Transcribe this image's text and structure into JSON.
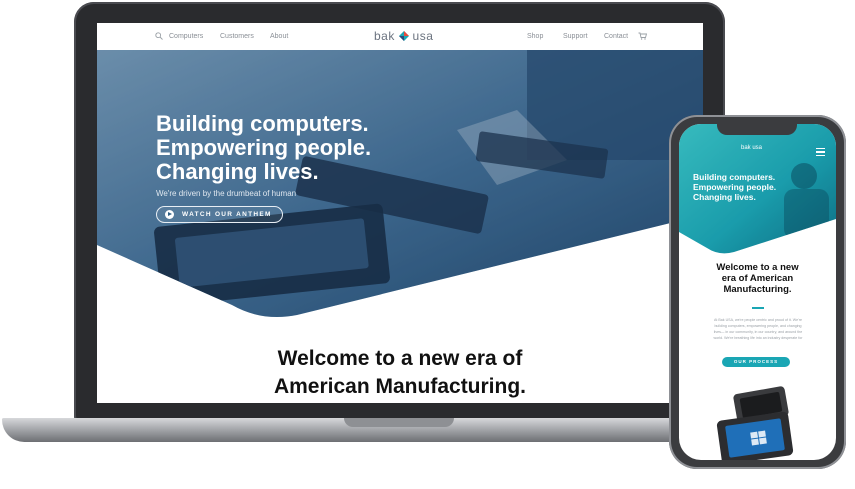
{
  "laptop": {
    "nav": {
      "left_items": [
        "Computers",
        "Customers",
        "About"
      ],
      "logo_left": "bak",
      "logo_right": "usa",
      "right_items": [
        "Shop",
        "Support",
        "Contact"
      ]
    },
    "hero": {
      "title_lines": [
        "Building computers.",
        "Empowering people.",
        "Changing lives."
      ],
      "subtitle": "We're driven by the drumbeat of human",
      "button_label": "WATCH OUR ANTHEM"
    },
    "welcome_lines": [
      "Welcome to a new era of",
      "American Manufacturing."
    ]
  },
  "phone": {
    "logo": "bak usa",
    "hero_title_lines": [
      "Building computers.",
      "Empowering people.",
      "Changing lives."
    ],
    "welcome_lines": [
      "Welcome to a new",
      "era of American",
      "Manufacturing."
    ],
    "body_lines": [
      "At Bak USA, we're people centric and proud of it. We're",
      "building computers, empowering people, and changing",
      "lives— in our community, in our country, and around the",
      "world. We're breathing life into an industry desperate for"
    ],
    "button_label": "OUR PROCESS"
  },
  "colors": {
    "accent": "#1aa6b4",
    "hero_blue": "#2f5f85",
    "device_dark": "#2a2b2e"
  },
  "icons": [
    "search-icon",
    "cart-icon",
    "play-icon",
    "menu-icon"
  ]
}
